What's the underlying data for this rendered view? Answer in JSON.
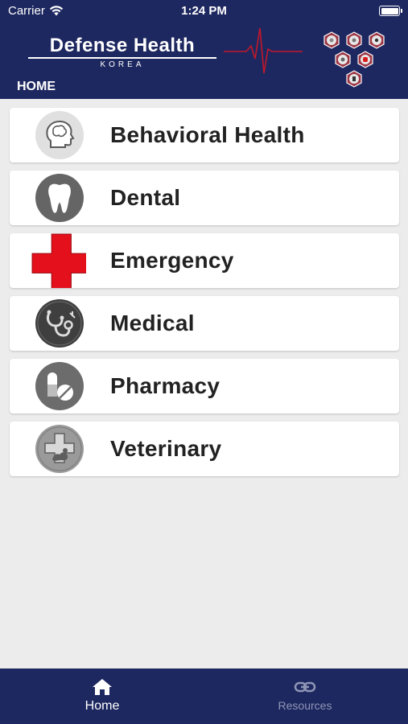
{
  "status_bar": {
    "carrier": "Carrier",
    "time": "1:24 PM"
  },
  "header": {
    "brand_title": "Defense Health",
    "brand_subtitle": "KOREA",
    "page_label": "HOME",
    "background_color": "#1e2860",
    "pulse_color": "#c0182a"
  },
  "services": [
    {
      "label": "Behavioral Health",
      "icon": "brain-head-icon"
    },
    {
      "label": "Dental",
      "icon": "tooth-icon"
    },
    {
      "label": "Emergency",
      "icon": "red-cross-icon"
    },
    {
      "label": "Medical",
      "icon": "stethoscope-icon"
    },
    {
      "label": "Pharmacy",
      "icon": "pills-icon"
    },
    {
      "label": "Veterinary",
      "icon": "veterinary-cross-icon"
    }
  ],
  "tabbar": {
    "home_label": "Home",
    "resources_label": "Resources",
    "active_tab": "Home"
  }
}
